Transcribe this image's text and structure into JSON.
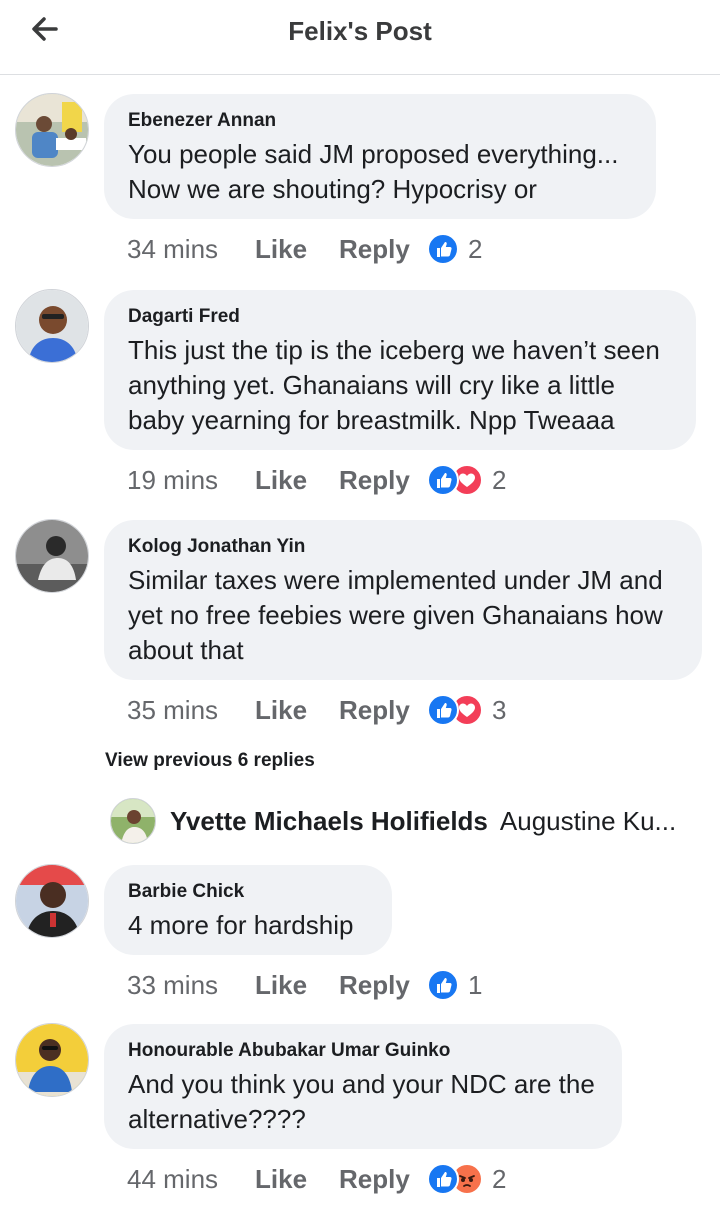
{
  "header": {
    "title": "Felix's Post",
    "back_icon": "arrow-left-icon"
  },
  "comments": [
    {
      "author": "Ebenezer Annan",
      "lines": [
        "You people said JM proposed everything...",
        "Now we are shouting? Hypocrisy or"
      ],
      "time": "34 mins",
      "like": "Like",
      "reply": "Reply",
      "reactions": [
        "like"
      ],
      "reaction_count": "2"
    },
    {
      "author": "Dagarti Fred",
      "lines": [
        "This just the tip is the iceberg we haven’t seen",
        "anything yet. Ghanaians will cry like a little",
        "baby yearning for breastmilk. Npp Tweaaa"
      ],
      "time": "19 mins",
      "like": "Like",
      "reply": "Reply",
      "reactions": [
        "like",
        "love"
      ],
      "reaction_count": "2"
    },
    {
      "author": "Kolog Jonathan Yin",
      "lines": [
        "Similar taxes were implemented under JM and",
        "yet no free feebies were given Ghanaians how",
        "about that"
      ],
      "time": "35 mins",
      "like": "Like",
      "reply": "Reply",
      "reactions": [
        "like",
        "love"
      ],
      "reaction_count": "3"
    },
    {
      "author": "Barbie Chick",
      "lines": [
        "4 more for hardship"
      ],
      "time": "33 mins",
      "like": "Like",
      "reply": "Reply",
      "reactions": [
        "like"
      ],
      "reaction_count": "1"
    },
    {
      "author": "Honourable Abubakar Umar Guinko",
      "lines": [
        "And you think you and your NDC are the",
        "alternative????"
      ],
      "time": "44 mins",
      "like": "Like",
      "reply": "Reply",
      "reactions": [
        "like",
        "angry"
      ],
      "reaction_count": "2"
    }
  ],
  "view_previous": "View previous 6 replies",
  "reply_preview": {
    "name": "Yvette Michaels Holifields",
    "text": "Augustine Ku..."
  },
  "colors": {
    "like": "#1877f2",
    "love": "#f33e58",
    "angry": "#f7714b",
    "bubble": "#f0f2f5",
    "meta": "#65676b"
  }
}
